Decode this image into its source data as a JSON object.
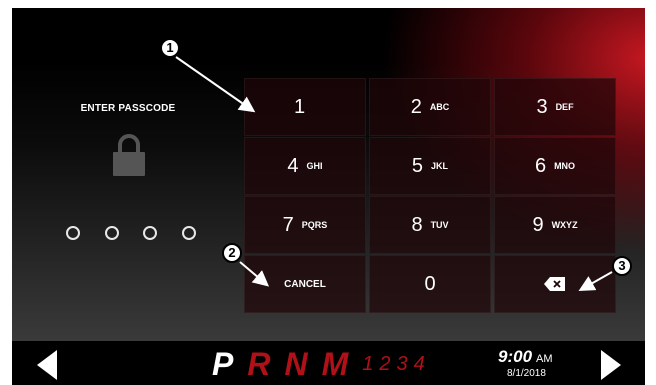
{
  "passcode": {
    "title": "ENTER PASSCODE",
    "dot_count": 4
  },
  "keypad": {
    "keys": [
      {
        "num": "1",
        "letters": ""
      },
      {
        "num": "2",
        "letters": "ABC"
      },
      {
        "num": "3",
        "letters": "DEF"
      },
      {
        "num": "4",
        "letters": "GHI"
      },
      {
        "num": "5",
        "letters": "JKL"
      },
      {
        "num": "6",
        "letters": "MNO"
      },
      {
        "num": "7",
        "letters": "PQRS"
      },
      {
        "num": "8",
        "letters": "TUV"
      },
      {
        "num": "9",
        "letters": "WXYZ"
      }
    ],
    "cancel_label": "CANCEL",
    "zero": "0",
    "backspace_icon": "backspace-icon"
  },
  "callouts": [
    "1",
    "2",
    "3"
  ],
  "bottom_bar": {
    "gears": [
      "P",
      "R",
      "N",
      "M"
    ],
    "gear_numbers": [
      "1",
      "2",
      "3",
      "4"
    ],
    "time": "9:00",
    "ampm": "AM",
    "date": "8/1/2018",
    "left_icon": "arrow-left-icon",
    "right_icon": "arrow-right-icon"
  },
  "colors": {
    "accent_red": "#b01018",
    "background": "#000000",
    "key_bg": "#1e0608"
  }
}
